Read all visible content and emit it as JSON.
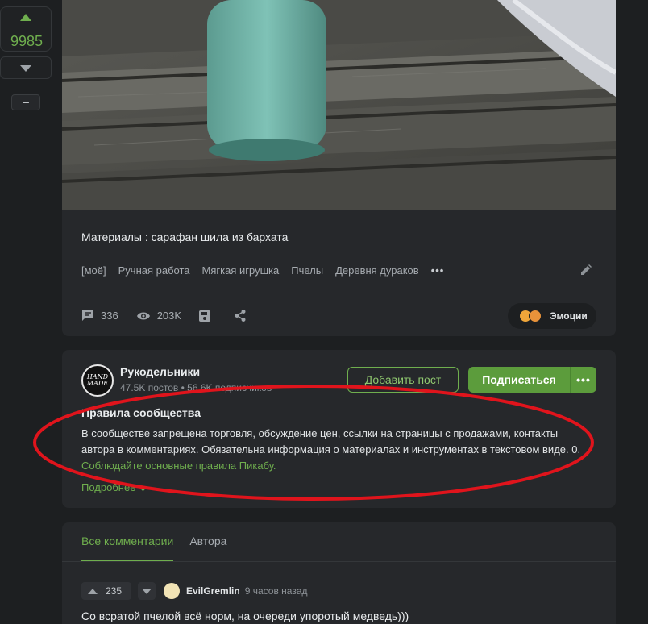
{
  "rating": {
    "value": "9985",
    "collapse_label": "–"
  },
  "post": {
    "text": "Материалы : сарафан шила из бархата",
    "tags": [
      "[моё]",
      "Ручная работа",
      "Мягкая игрушка",
      "Пчелы",
      "Деревня дураков"
    ],
    "tags_more": "•••",
    "comments_count": "336",
    "views_count": "203K",
    "emotions_label": "Эмоции",
    "icons": [
      "comment-icon",
      "eye-icon",
      "save-icon",
      "share-icon",
      "edit-icon"
    ]
  },
  "community": {
    "avatar_text": "HAND MADE",
    "name": "Рукодельники",
    "meta": "47.5K постов • 56.6K подписчиков",
    "add_post_label": "Добавить пост",
    "subscribe_label": "Подписаться",
    "subscribe_more": "•••",
    "rules_title": "Правила сообщества",
    "rules_text": "В сообществе запрещена торговля, обсуждение цен, ссылки на страницы с продажами, контакты автора в комментариях. Обязательна информация о материалах и инструментах в текстовом виде. 0.",
    "rules_link": "Соблюдайте основные правила Пикабу.",
    "more_label": "Подробнее ⌄"
  },
  "comments": {
    "tabs": [
      "Все комментарии",
      "Автора"
    ],
    "items": [
      {
        "votes": "235",
        "author": "EvilGremlin",
        "time": "9 часов назад",
        "text": "Со всратой пчелой всё норм, на очереди упоротый медведь)))"
      }
    ]
  },
  "colors": {
    "accent": "#6fae4e",
    "annotation": "#e0141c"
  }
}
